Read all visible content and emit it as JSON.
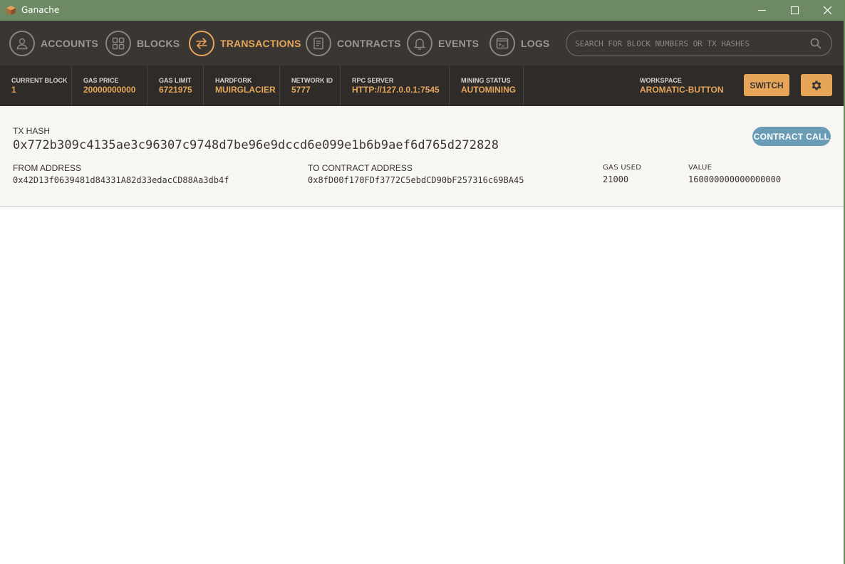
{
  "window": {
    "title": "Ganache",
    "app_icon": "ganache-logo-icon",
    "controls": {
      "minimize": "minimize-icon",
      "maximize": "maximize-icon",
      "close": "close-icon"
    }
  },
  "nav": {
    "items": [
      {
        "label": "ACCOUNTS",
        "icon": "user-icon",
        "active": false
      },
      {
        "label": "BLOCKS",
        "icon": "grid-icon",
        "active": false
      },
      {
        "label": "TRANSACTIONS",
        "icon": "swap-arrows-icon",
        "active": true
      },
      {
        "label": "CONTRACTS",
        "icon": "document-icon",
        "active": false
      },
      {
        "label": "EVENTS",
        "icon": "bell-icon",
        "active": false
      },
      {
        "label": "LOGS",
        "icon": "terminal-icon",
        "active": false
      }
    ],
    "search_placeholder": "SEARCH FOR BLOCK NUMBERS OR TX HASHES"
  },
  "status": {
    "current_block": {
      "label": "CURRENT BLOCK",
      "value": "1"
    },
    "gas_price": {
      "label": "GAS PRICE",
      "value": "20000000000"
    },
    "gas_limit": {
      "label": "GAS LIMIT",
      "value": "6721975"
    },
    "hardfork": {
      "label": "HARDFORK",
      "value": "MUIRGLACIER"
    },
    "network_id": {
      "label": "NETWORK ID",
      "value": "5777"
    },
    "rpc_server": {
      "label": "RPC SERVER",
      "value": "HTTP://127.0.0.1:7545"
    },
    "mining_status": {
      "label": "MINING STATUS",
      "value": "AUTOMINING"
    },
    "workspace": {
      "label": "WORKSPACE",
      "value": "AROMATIC-BUTTON"
    },
    "switch_label": "SWITCH"
  },
  "transaction": {
    "hash_label": "TX HASH",
    "hash": "0x772b309c4135ae3c96307c9748d7be96e9dccd6e099e1b6b9aef6d765d272828",
    "type_badge": "CONTRACT CALL",
    "from_label": "FROM ADDRESS",
    "from": "0x42D13f0639481d84331A82d33edacCD88Aa3db4f",
    "to_label": "TO CONTRACT ADDRESS",
    "to": "0x8fD00f170FDf3772C5ebdCD90bF257316c69BA45",
    "gas_used_label": "GAS USED",
    "gas_used": "21000",
    "value_label": "VALUE",
    "value": "160000000000000000"
  },
  "colors": {
    "titlebar": "#6d8a64",
    "navbar": "#3a3632",
    "statusbar": "#2e2b28",
    "accent": "#e7a55a",
    "badge": "#6a9db5"
  }
}
